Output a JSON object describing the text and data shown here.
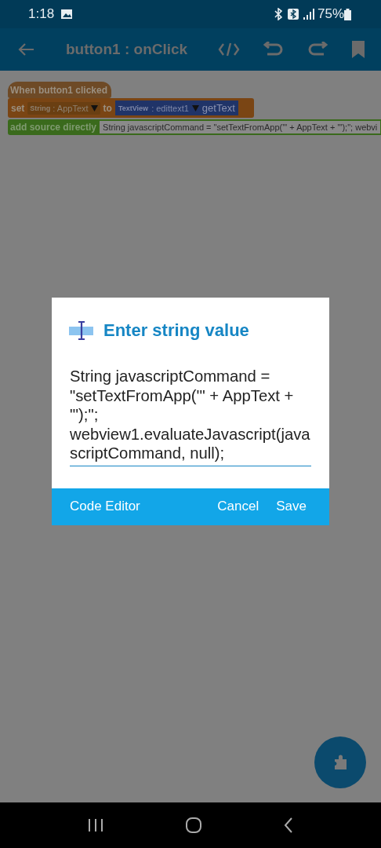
{
  "status_bar": {
    "time": "1:18",
    "battery": "75%"
  },
  "app_bar": {
    "title": "button1 : onClick"
  },
  "blocks": [
    {
      "kind": "event",
      "label": "When button1 clicked"
    },
    {
      "kind": "setter",
      "keyword": "set",
      "variable_type": "String",
      "variable": ": AppText",
      "connector": "to",
      "component_type": "TextView",
      "component": ": edittext1",
      "method": "getText"
    },
    {
      "kind": "source",
      "label": "add source directly",
      "code": "String javascriptCommand = \"setTextFromApp('\" + AppText + \"');\"; webvi"
    }
  ],
  "dialog": {
    "title": "Enter string value",
    "value": "String javascriptCommand = \"setTextFromApp('\" + AppText + \"');\"; webview1.evaluateJavascript(javascriptCommand, null);",
    "buttons": [
      "Code Editor",
      "Cancel",
      "Save"
    ]
  }
}
